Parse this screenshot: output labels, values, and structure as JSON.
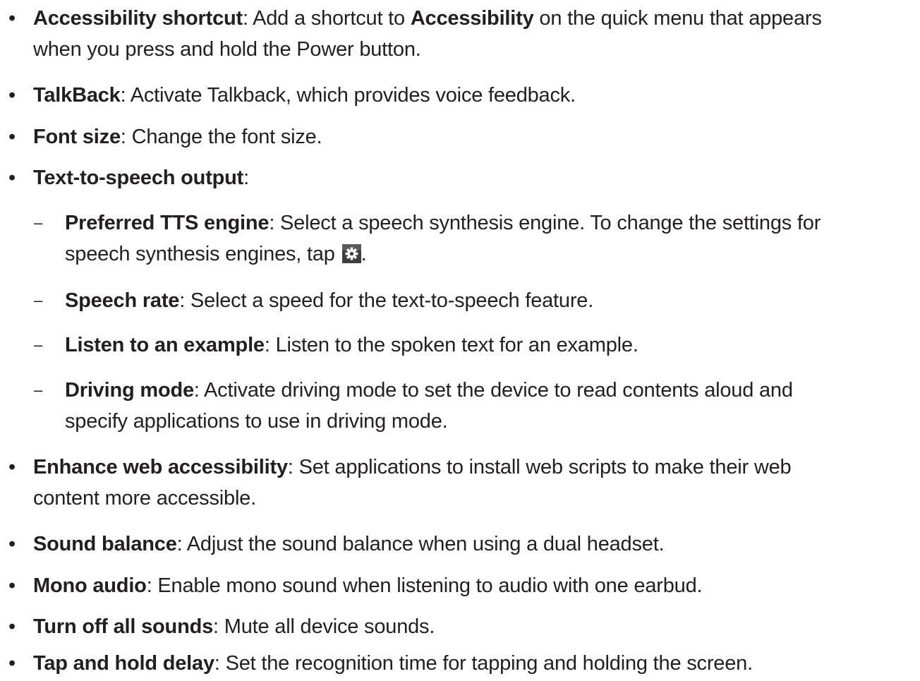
{
  "bullet_glyph": "•",
  "dash_glyph": "–",
  "gear_icon": "gear-icon",
  "items": [
    {
      "term": "Accessibility shortcut",
      "line1_a": ": Add a shortcut to ",
      "line1_b": "Accessibility",
      "line1_c": " on the quick menu that appears",
      "line2": "when you press and hold the Power button."
    },
    {
      "term": "TalkBack",
      "desc": ": Activate Talkback, which provides voice feedback."
    },
    {
      "term": "Font size",
      "desc": ": Change the font size."
    },
    {
      "term": "Text-to-speech output",
      "desc": ":"
    },
    {
      "term": "Preferred TTS engine",
      "line1": ": Select a speech synthesis engine. To change the settings for",
      "line2": "speech synthesis engines, tap ",
      "line2_end": "."
    },
    {
      "term": "Speech rate",
      "desc": ": Select a speed for the text-to-speech feature."
    },
    {
      "term": "Listen to an example",
      "desc": ": Listen to the spoken text for an example."
    },
    {
      "term": "Driving mode",
      "line1": ": Activate driving mode to set the device to read contents aloud and",
      "line2": "specify applications to use in driving mode."
    },
    {
      "term": "Enhance web accessibility",
      "line1": ": Set applications to install web scripts to make their web",
      "line2": "content more accessible."
    },
    {
      "term": "Sound balance",
      "desc": ": Adjust the sound balance when using a dual headset."
    },
    {
      "term": "Mono audio",
      "desc": ": Enable mono sound when listening to audio with one earbud."
    },
    {
      "term": "Turn off all sounds",
      "desc": ": Mute all device sounds."
    },
    {
      "term": "Tap and hold delay",
      "desc": ": Set the recognition time for tapping and holding the screen."
    }
  ]
}
